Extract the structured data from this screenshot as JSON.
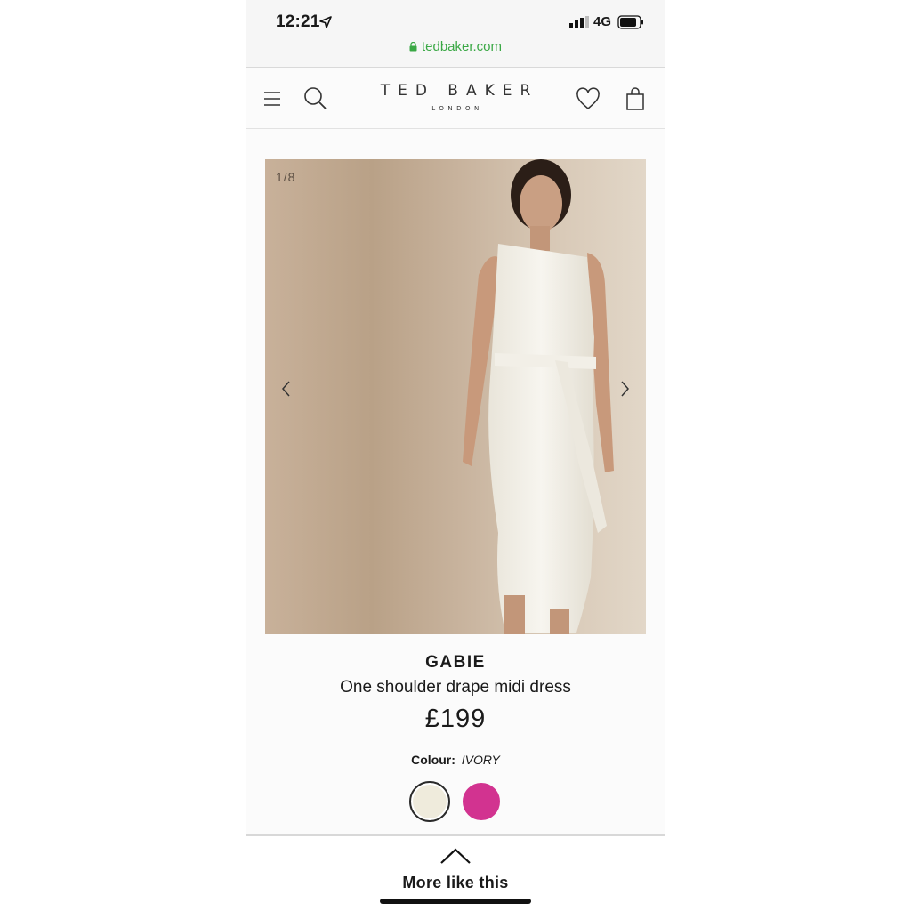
{
  "status_bar": {
    "time": "12:21",
    "network": "4G",
    "url": "tedbaker.com"
  },
  "header": {
    "brand_name": "TED BAKER",
    "brand_sub": "LONDON",
    "icons": [
      "menu-icon",
      "search-icon",
      "heart-icon",
      "shopping-bag-icon"
    ]
  },
  "gallery": {
    "counter": "1/8"
  },
  "product": {
    "name": "GABIE",
    "description": "One shoulder drape midi dress",
    "price": "£199",
    "colour_label": "Colour:",
    "colour_value": "IVORY",
    "swatches": [
      {
        "name": "ivory",
        "color": "#efebdc",
        "selected": true
      },
      {
        "name": "pink",
        "color": "#d23390",
        "selected": false
      }
    ]
  },
  "more_like_this": {
    "label": "More like this"
  },
  "colors": {
    "url_green": "#3aa845",
    "text": "#1a1a1a"
  }
}
